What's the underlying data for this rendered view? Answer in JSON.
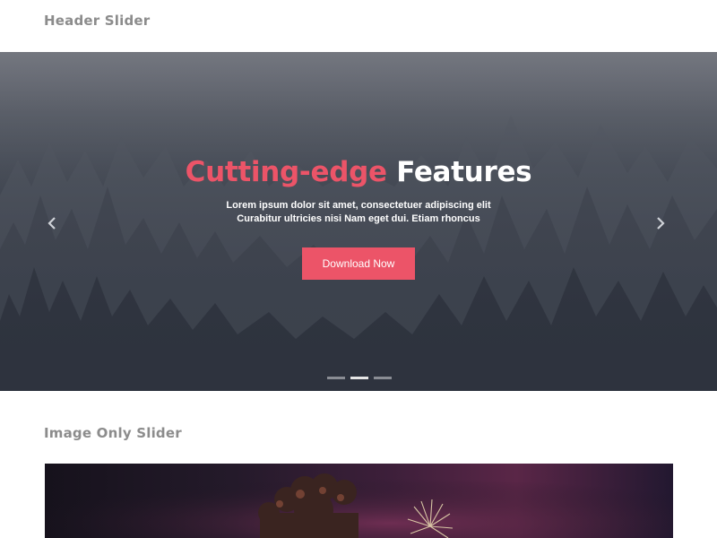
{
  "sections": {
    "header_slider_title": "Header Slider",
    "image_slider_title": "Image Only Slider"
  },
  "hero": {
    "headline_accent": "Cutting-edge",
    "headline_rest": "Features",
    "line1": "Lorem ipsum dolor sit amet, consectetuer adipiscing elit",
    "line2": "Curabitur ultricies nisi Nam eget dui. Etiam rhoncus",
    "cta_label": "Download Now",
    "prev_icon": "chevron-left-icon",
    "next_icon": "chevron-right-icon",
    "slides_total": 3,
    "active_slide": 2
  },
  "colors": {
    "accent": "#ec5468",
    "section_title": "#8c8c8c",
    "dot_active": "#e6e6e6",
    "dot_inactive": "#8a8d94"
  }
}
